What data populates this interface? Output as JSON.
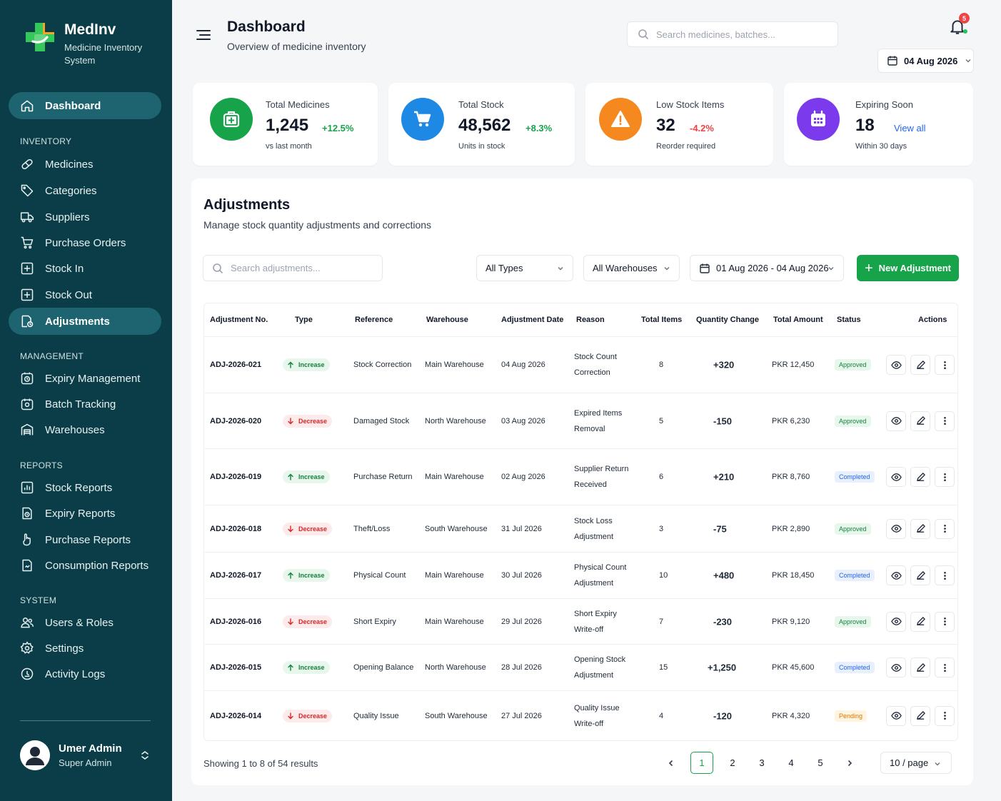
{
  "brand": {
    "name": "MedInv",
    "subtitle": "Medicine Inventory System"
  },
  "nav": {
    "dashboard": "Dashboard",
    "sections": {
      "inventory": "INVENTORY",
      "management": "MANAGEMENT",
      "reports": "REPORTS",
      "system": "SYSTEM"
    },
    "items": {
      "medicines": "Medicines",
      "categories": "Categories",
      "suppliers": "Suppliers",
      "purchase_orders": "Purchase Orders",
      "stock_in": "Stock In",
      "stock_out": "Stock Out",
      "adjustments": "Adjustments",
      "expiry_management": "Expiry Management",
      "batch_tracking": "Batch Tracking",
      "warehouses": "Warehouses",
      "stock_reports": "Stock Reports",
      "expiry_reports": "Expiry Reports",
      "purchase_reports": "Purchase Reports",
      "consumption_reports": "Consumption Reports",
      "users_roles": "Users & Roles",
      "settings": "Settings",
      "activity_logs": "Activity Logs"
    }
  },
  "user": {
    "name": "Umer Admin",
    "role": "Super Admin"
  },
  "header": {
    "title": "Dashboard",
    "subtitle": "Overview of medicine inventory",
    "search_placeholder": "Search medicines, batches...",
    "notification_count": "5",
    "date": "04 Aug 2026"
  },
  "stats": {
    "total_medicines": {
      "label": "Total Medicines",
      "value": "1,245",
      "delta": "+12.5%",
      "foot": "vs last month",
      "color": "#16a34a"
    },
    "total_stock": {
      "label": "Total Stock",
      "value": "48,562",
      "delta": "+8.3%",
      "foot": "Units in stock",
      "color": "#1e88e5"
    },
    "low_stock": {
      "label": "Low Stock Items",
      "value": "32",
      "delta": "-4.2%",
      "foot": "Reorder required",
      "color": "#f5891f"
    },
    "expiring": {
      "label": "Expiring Soon",
      "value": "18",
      "link": "View all",
      "foot": "Within 30 days",
      "color": "#7c3aed"
    }
  },
  "adjustments": {
    "title": "Adjustments",
    "subtitle": "Manage stock quantity adjustments and corrections",
    "search_placeholder": "Search adjustments...",
    "type_filter": "All Types",
    "warehouse_filter": "All Warehouses",
    "date_range": "01 Aug 2026 - 04 Aug 2026",
    "new_button": "New Adjustment",
    "columns": {
      "adj_no": "Adjustment No.",
      "type": "Type",
      "reference": "Reference",
      "warehouse": "Warehouse",
      "date": "Adjustment Date",
      "reason": "Reason",
      "total_items": "Total Items",
      "qty_change": "Quantity Change",
      "total_amount": "Total Amount",
      "status": "Status",
      "actions": "Actions"
    },
    "rows": [
      {
        "id": "ADJ-2026-021",
        "type": "Increase",
        "reference": "Stock Correction",
        "warehouse": "Main Warehouse",
        "date": "04 Aug 2026",
        "reason": "Stock Count Correction",
        "items": "8",
        "qty": "+320",
        "amount": "PKR 12,450",
        "status": "Approved"
      },
      {
        "id": "ADJ-2026-020",
        "type": "Decrease",
        "reference": "Damaged Stock",
        "warehouse": "North Warehouse",
        "date": "03 Aug 2026",
        "reason": "Expired Items Removal",
        "items": "5",
        "qty": "-150",
        "amount": "PKR 6,230",
        "status": "Approved"
      },
      {
        "id": "ADJ-2026-019",
        "type": "Increase",
        "reference": "Purchase Return",
        "warehouse": "Main Warehouse",
        "date": "02 Aug 2026",
        "reason": "Supplier Return Received",
        "items": "6",
        "qty": "+210",
        "amount": "PKR 8,760",
        "status": "Completed"
      },
      {
        "id": "ADJ-2026-018",
        "type": "Decrease",
        "reference": "Theft/Loss",
        "warehouse": "South Warehouse",
        "date": "31 Jul 2026",
        "reason": "Stock Loss Adjustment",
        "items": "3",
        "qty": "-75",
        "amount": "PKR 2,890",
        "status": "Approved"
      },
      {
        "id": "ADJ-2026-017",
        "type": "Increase",
        "reference": "Physical Count",
        "warehouse": "Main Warehouse",
        "date": "30 Jul 2026",
        "reason": "Physical Count Adjustment",
        "items": "10",
        "qty": "+480",
        "amount": "PKR 18,450",
        "status": "Completed"
      },
      {
        "id": "ADJ-2026-016",
        "type": "Decrease",
        "reference": "Short Expiry",
        "warehouse": "Main Warehouse",
        "date": "29 Jul 2026",
        "reason": "Short Expiry Write-off",
        "items": "7",
        "qty": "-230",
        "amount": "PKR 9,120",
        "status": "Approved"
      },
      {
        "id": "ADJ-2026-015",
        "type": "Increase",
        "reference": "Opening Balance",
        "warehouse": "North Warehouse",
        "date": "28 Jul 2026",
        "reason": "Opening Stock Adjustment",
        "items": "15",
        "qty": "+1,250",
        "amount": "PKR 45,600",
        "status": "Completed"
      },
      {
        "id": "ADJ-2026-014",
        "type": "Decrease",
        "reference": "Quality Issue",
        "warehouse": "South Warehouse",
        "date": "27 Jul 2026",
        "reason": "Quality Issue Write-off",
        "items": "4",
        "qty": "-120",
        "amount": "PKR 4,320",
        "status": "Pending"
      }
    ],
    "showing": "Showing 1 to 8 of 54 results",
    "pages": [
      "1",
      "2",
      "3",
      "4",
      "5"
    ],
    "per_page": "10 / page"
  },
  "colors": {
    "sidebar": "#0a3d47",
    "accent": "#16a34a",
    "positive": "#16a34a",
    "negative": "#ef4444"
  }
}
